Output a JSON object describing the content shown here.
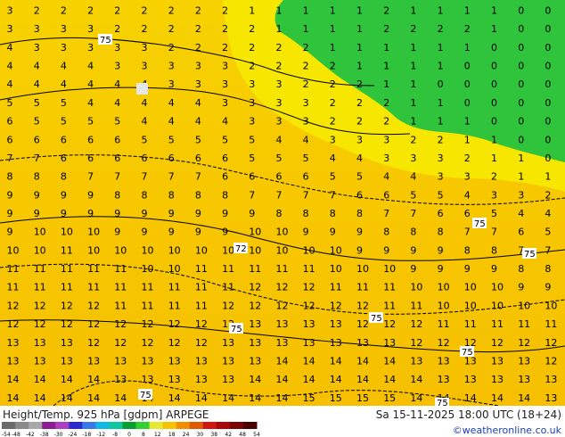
{
  "title": "Height/Temp. 925 hPa [gdpm] ARPEGE",
  "valid_time": "Sa 15-11-2025 18:00 UTC (18+24)",
  "credit": "©weatheronline.co.uk",
  "colorbar": {
    "ticks": [
      "-54",
      "-48",
      "-42",
      "-38",
      "-30",
      "-24",
      "-18",
      "-12",
      "-8",
      "0",
      "8",
      "12",
      "18",
      "24",
      "30",
      "38",
      "42",
      "48",
      "54"
    ],
    "colors": [
      "#6b6b6b",
      "#8a8a8a",
      "#a8a8a8",
      "#8e1c93",
      "#b03fc0",
      "#2b2bd0",
      "#3a78ea",
      "#10b8e6",
      "#10c8a0",
      "#08a030",
      "#30d030",
      "#e8e830",
      "#f6c300",
      "#f09000",
      "#e05a00",
      "#d01810",
      "#a80808",
      "#7a0404",
      "#4a0000"
    ]
  },
  "map": {
    "colors": {
      "green": "#2fc43b",
      "yellow": "#f7e600",
      "gold": "#f7c500",
      "contour": "#000000"
    },
    "contour_labels": [
      "75",
      "75",
      "72",
      "75",
      "75",
      "75",
      "75",
      "75",
      "75"
    ],
    "grid_rows": [
      "3 2 2 2 2 2 2 2 2 1 1 1 1 1 2 1 1 1 1 0 0",
      "3 3 3 3 2 2 2 2 2 2 1 1 1 1 2 2 2 2 1 0 0",
      "4 3 3 3 3 3 2 2 2 2 2 2 1 1 1 1 1 1 0 0 0",
      "4 4 4 4 3 3 3 3 3 2 2 2 2 1 1 1 1 0 0 0 0",
      "4 4 4 4 4 4 3 3 3 3 3 2 2 2 1 1 0 0 0 0 0",
      "5 5 5 4 4 4 4 4 3 3 3 3 2 2 2 1 1 0 0 0 0",
      "6 5 5 5 5 4 4 4 4 3 3 3 2 2 2 1 1 1 0 0 0",
      "6 6 6 6 6 5 5 5 5 5 4 4 3 3 3 2 2 1 1 0 0",
      "7 7 6 6 6 6 6 6 6 5 5 5 4 4 3 3 3 2 1 1 0",
      "8 8 8 7 7 7 7 7 6 6 6 6 5 5 4 4 3 3 2 1 1",
      "9 9 9 9 8 8 8 8 8 7 7 7 7 6 6 5 5 4 3 3 2",
      "9 9 9 9 9 9 9 9 9 9 8 8 8 8 7 7 6 6 5 4 4",
      "9 10 10 10 9 9 9 9 9 10 10 9 9 9 8 8 8 7 7 6 5",
      "10 10 11 10 10 10 10 10 10 10 10 10 10 9 9 9 9 8 8 7 7",
      "11 11 11 11 11 10 10 11 11 11 11 11 10 10 10 9 9 9 9 8 8",
      "11 11 11 11 11 11 11 11 11 12 12 12 11 11 11 10 10 10 10 9 9",
      "12 12 12 12 11 11 11 11 12 12 12 12 12 12 11 11 10 10 10 10 10",
      "12 12 12 12 12 12 12 12 12 13 13 13 13 12 12 12 11 11 11 11 11",
      "13 13 13 12 12 12 12 12 13 13 13 13 13 13 13 12 12 12 12 12 12",
      "13 13 13 13 13 13 13 13 13 13 14 14 14 14 14 13 13 13 13 13 12",
      "14 14 14 14 13 13 13 13 13 14 14 14 14 14 14 14 13 13 13 13 13",
      "14 14 14 14 14 14 14 14 14 14 14 15 15 15 15 14 14 14 14 14 13"
    ]
  }
}
